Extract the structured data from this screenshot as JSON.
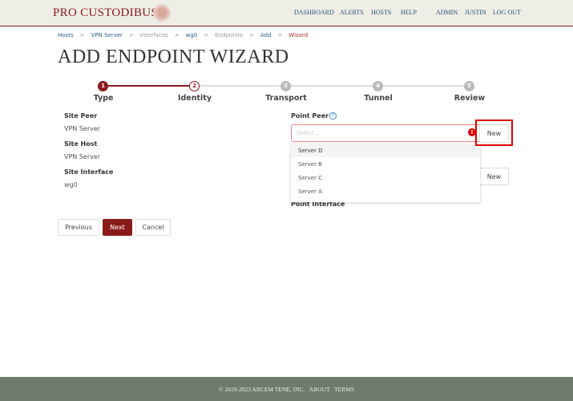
{
  "header": {
    "logo": "PRO CUSTODIBUS",
    "nav": [
      "DASHBOARD",
      "ALERTS",
      "HOSTS",
      "HELP"
    ],
    "user_nav": [
      "ADMIN",
      "JUSTIN",
      "LOG OUT"
    ]
  },
  "breadcrumb": [
    "Hosts",
    "VPN Server",
    "Interfaces",
    "wg0",
    "Endpoints",
    "Add",
    "Wizard"
  ],
  "title": "ADD ENDPOINT WIZARD",
  "steps": [
    {
      "n": "1",
      "label": "Type"
    },
    {
      "n": "2",
      "label": "Identity"
    },
    {
      "n": "3",
      "label": "Transport"
    },
    {
      "n": "4",
      "label": "Tunnel"
    },
    {
      "n": "5",
      "label": "Review"
    }
  ],
  "current_step": 2,
  "site": {
    "peer_label": "Site Peer",
    "peer": "VPN Server",
    "host_label": "Site Host",
    "host": "VPN Server",
    "iface_label": "Site Interface",
    "iface": "wg0"
  },
  "point": {
    "peer_label": "Point Peer",
    "help": "?",
    "placeholder": "Select...",
    "error": "!",
    "new": "New",
    "new2": "New",
    "iface_label": "Point Interface",
    "options": [
      "Server D",
      "Server B",
      "Server C",
      "Server A"
    ]
  },
  "buttons": {
    "previous": "Previous",
    "next": "Next",
    "cancel": "Cancel"
  },
  "footer": {
    "copyright": "© 2019-2023 ARCEM TENE, INC.",
    "about": "ABOUT",
    "terms": "TERMS"
  },
  "colors": {
    "brand": "#8b1a1a",
    "footer": "#6f7c6d",
    "highlight": "#e00000"
  }
}
